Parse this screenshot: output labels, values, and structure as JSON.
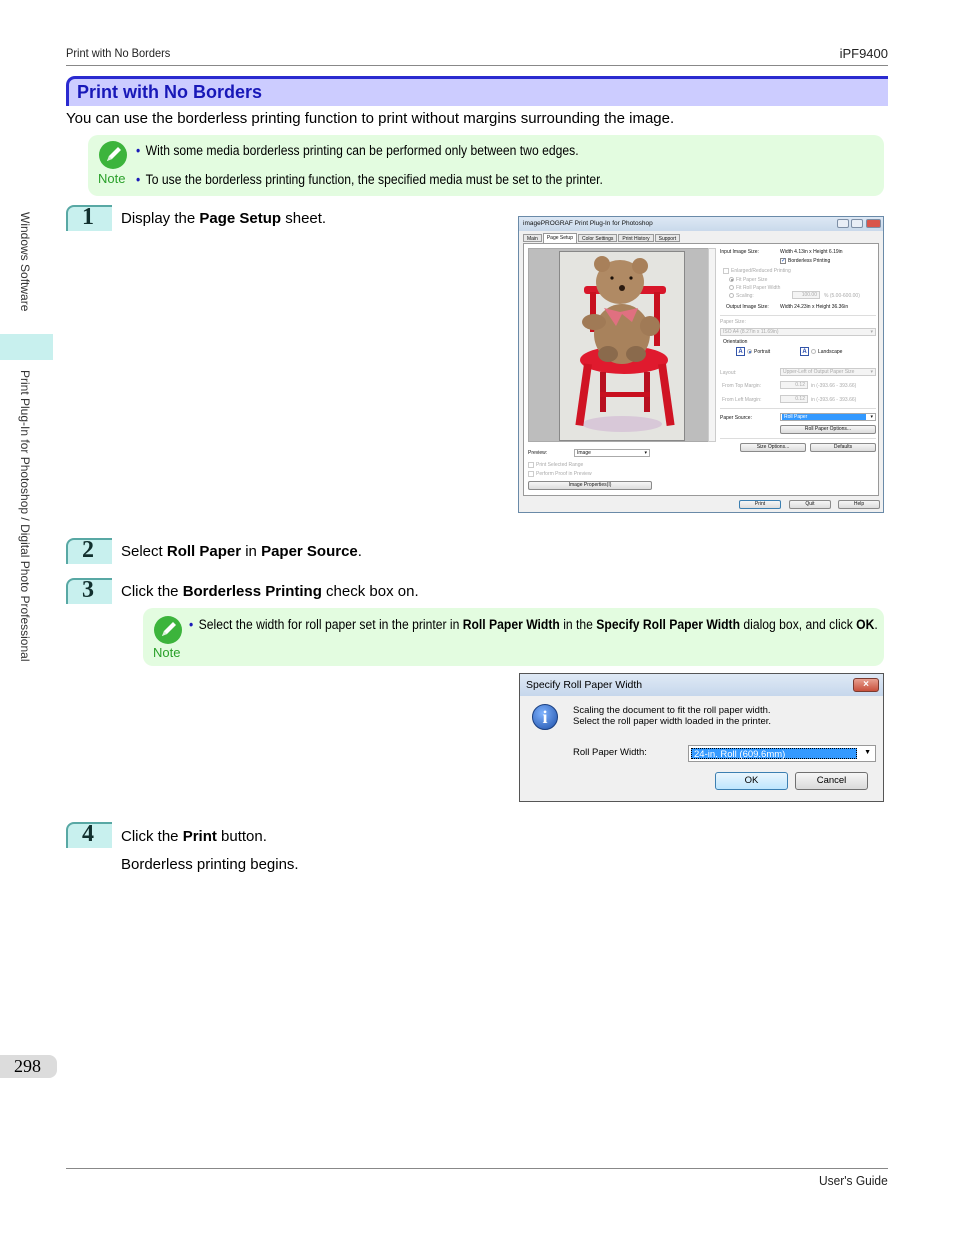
{
  "header": {
    "left": "Print with No Borders",
    "right": "iPF9400"
  },
  "section_title": "Print with No Borders",
  "intro": "You can use the borderless printing function to print without margins surrounding the image.",
  "note1": {
    "label": "Note",
    "items": [
      "With some media borderless printing can be performed only between two edges.",
      "To use the borderless printing function, the specified media must be set to the printer."
    ]
  },
  "steps": [
    {
      "num": "1",
      "parts": [
        "Display the ",
        "Page Setup",
        " sheet."
      ]
    },
    {
      "num": "2",
      "parts": [
        "Select ",
        "Roll Paper",
        " in ",
        "Paper Source",
        "."
      ]
    },
    {
      "num": "3",
      "parts": [
        "Click the ",
        "Borderless Printing",
        " check box on."
      ]
    },
    {
      "num": "4",
      "parts": [
        "Click the ",
        "Print",
        " button."
      ],
      "sub": "Borderless printing begins."
    }
  ],
  "note2": {
    "label": "Note",
    "parts": [
      "Select the width for roll paper set in the printer in ",
      "Roll Paper Width",
      " in the ",
      "Specify Roll Paper Width",
      " dialog box, and click ",
      "OK",
      "."
    ]
  },
  "side_tabs": {
    "upper": "Windows Software",
    "lower": "Print Plug-In for Photoshop / Digital Photo Professional"
  },
  "page_number": "298",
  "footer": {
    "right": "User's Guide"
  },
  "plugin_window": {
    "title": "imagePROGRAF Print Plug-In for Photoshop",
    "tabs": [
      "Main",
      "Page Setup",
      "Color Settings",
      "Print History",
      "Support"
    ],
    "active_tab": "Page Setup",
    "input_image_size_label": "Input Image Size:",
    "input_image_size_value": "Width 4.13in x Height 6.19in",
    "borderless_printing": {
      "label": "Borderless Printing",
      "checked": true
    },
    "enlarged_reduced": {
      "label": "Enlarged/Reduced Printing",
      "checked": false
    },
    "radio_fit_paper": "Fit Paper Size",
    "radio_fit_roll": "Fit Roll Paper Width",
    "radio_scaling": "Scaling:",
    "scaling_value": "100.00",
    "scaling_range": "% (5.00-600.00)",
    "output_image_size_label": "Output Image Size:",
    "output_image_size_value": "Width 24.23in x Height 36.36in",
    "paper_size_label": "Paper Size:",
    "paper_size_value": "ISO A4 (8.27in x 11.69in)",
    "orientation_label": "Orientation",
    "portrait": "Portrait",
    "landscape": "Landscape",
    "layout_label": "Layout:",
    "layout_value": "Upper-Left of Output Paper Size",
    "top_margin_label": "From Top Margin:",
    "top_margin_value": "0.12",
    "top_margin_range": "in (-393.66 - 393.66)",
    "left_margin_label": "From Left Margin:",
    "left_margin_value": "0.12",
    "left_margin_range": "in (-393.66 - 393.66)",
    "paper_source_label": "Paper Source:",
    "paper_source_value": "Roll Paper",
    "roll_paper_options": "Roll Paper Options...",
    "size_options": "Size Options...",
    "defaults": "Defaults",
    "preview_label": "Preview:",
    "preview_value": "Image",
    "print_selected_range": "Print Selected Range",
    "perform_proof": "Perform Proof in Preview",
    "image_properties": "Image Properties(I)",
    "print_btn": "Print",
    "quit_btn": "Quit",
    "help_btn": "Help"
  },
  "roll_dialog": {
    "title": "Specify Roll Paper Width",
    "message_line1": "Scaling the document to fit the roll paper width.",
    "message_line2": "Select the roll paper width loaded in the printer.",
    "field_label": "Roll Paper Width:",
    "field_value": "24-in. Roll (609.6mm)",
    "ok": "OK",
    "cancel": "Cancel"
  }
}
